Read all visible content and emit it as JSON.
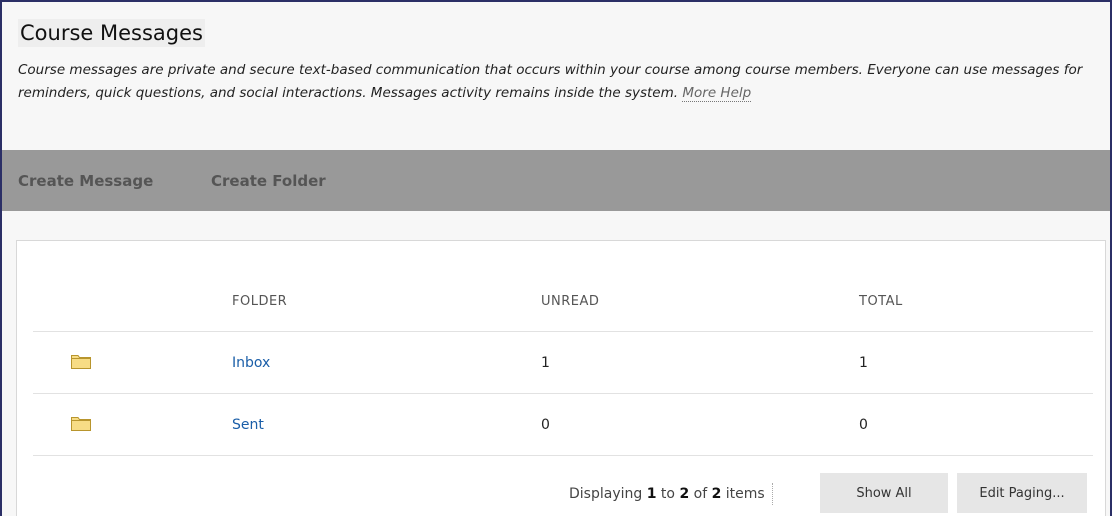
{
  "page": {
    "title": "Course Messages",
    "description": "Course messages are private and secure text-based communication that occurs within your course among course members. Everyone can use messages for reminders, quick questions, and social interactions. Messages activity remains inside the system.",
    "help_link": "More Help"
  },
  "actions": {
    "create_message": "Create Message",
    "create_folder": "Create Folder"
  },
  "table": {
    "headers": {
      "folder": "FOLDER",
      "unread": "UNREAD",
      "total": "TOTAL"
    },
    "rows": [
      {
        "icon": "folder-icon",
        "folder": "Inbox",
        "unread": "1",
        "total": "1"
      },
      {
        "icon": "folder-icon",
        "folder": "Sent",
        "unread": "0",
        "total": "0"
      }
    ]
  },
  "pagination": {
    "prefix": "Displaying",
    "start": "1",
    "to_word": "to",
    "end": "2",
    "of_word": "of",
    "count": "2",
    "items_word": "items",
    "show_all": "Show All",
    "edit_paging": "Edit Paging..."
  },
  "colors": {
    "frame_border": "#2b2f66",
    "action_bar": "#999999",
    "link": "#1a5ea8",
    "folder_icon_fill": "#f7dc85",
    "folder_icon_stroke": "#b8952d"
  }
}
